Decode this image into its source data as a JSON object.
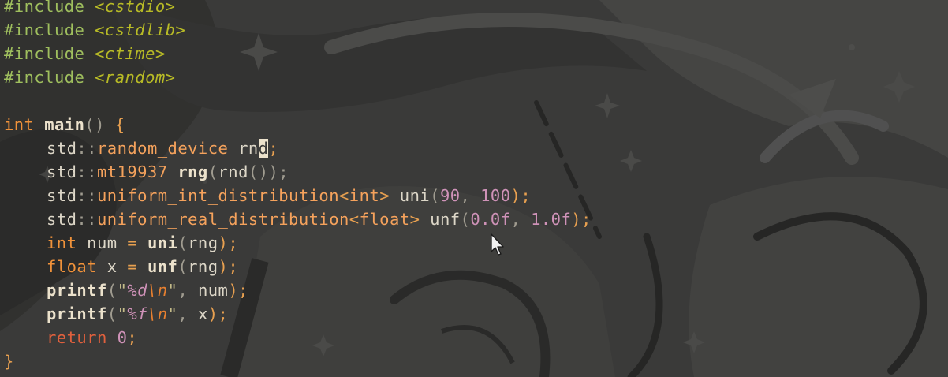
{
  "editor": {
    "lines": [
      {
        "tokens": [
          {
            "t": "#include ",
            "c": "c-pre"
          },
          {
            "t": "<cstdio>",
            "c": "c-hdr"
          }
        ]
      },
      {
        "tokens": [
          {
            "t": "#include ",
            "c": "c-pre"
          },
          {
            "t": "<cstdlib>",
            "c": "c-hdr"
          }
        ]
      },
      {
        "tokens": [
          {
            "t": "#include ",
            "c": "c-pre"
          },
          {
            "t": "<ctime>",
            "c": "c-hdr"
          }
        ]
      },
      {
        "tokens": [
          {
            "t": "#include ",
            "c": "c-pre"
          },
          {
            "t": "<random>",
            "c": "c-hdr"
          }
        ]
      },
      {
        "tokens": []
      },
      {
        "tokens": [
          {
            "t": "int",
            "c": "c-kw"
          },
          {
            "t": " ",
            "c": "c-var"
          },
          {
            "t": "main",
            "c": "c-fn"
          },
          {
            "t": "()",
            "c": "c-pu"
          },
          {
            "t": " {",
            "c": "c-op"
          }
        ]
      },
      {
        "indent": 1,
        "tokens": [
          {
            "t": "std",
            "c": "c-var"
          },
          {
            "t": "::",
            "c": "c-pu"
          },
          {
            "t": "random_device",
            "c": "c-ty"
          },
          {
            "t": " rn",
            "c": "c-var"
          },
          {
            "t": "d",
            "c": "cursor"
          },
          {
            "t": ";",
            "c": "c-op"
          }
        ]
      },
      {
        "indent": 1,
        "tokens": [
          {
            "t": "std",
            "c": "c-var"
          },
          {
            "t": "::",
            "c": "c-pu"
          },
          {
            "t": "mt19937",
            "c": "c-ty"
          },
          {
            "t": " ",
            "c": "c-var"
          },
          {
            "t": "rng",
            "c": "c-fn"
          },
          {
            "t": "(",
            "c": "c-pu"
          },
          {
            "t": "rnd",
            "c": "c-var"
          },
          {
            "t": "());",
            "c": "c-pu"
          }
        ]
      },
      {
        "indent": 1,
        "tokens": [
          {
            "t": "std",
            "c": "c-var"
          },
          {
            "t": "::",
            "c": "c-pu"
          },
          {
            "t": "uniform_int_distribution",
            "c": "c-ty"
          },
          {
            "t": "<",
            "c": "c-op"
          },
          {
            "t": "int",
            "c": "c-ty"
          },
          {
            "t": ">",
            "c": "c-op"
          },
          {
            "t": " uni",
            "c": "c-var"
          },
          {
            "t": "(",
            "c": "c-pu"
          },
          {
            "t": "90",
            "c": "c-num"
          },
          {
            "t": ", ",
            "c": "c-pu"
          },
          {
            "t": "100",
            "c": "c-num"
          },
          {
            "t": ");",
            "c": "c-op"
          }
        ]
      },
      {
        "indent": 1,
        "tokens": [
          {
            "t": "std",
            "c": "c-var"
          },
          {
            "t": "::",
            "c": "c-pu"
          },
          {
            "t": "uniform_real_distribution",
            "c": "c-ty"
          },
          {
            "t": "<",
            "c": "c-op"
          },
          {
            "t": "float",
            "c": "c-ty"
          },
          {
            "t": ">",
            "c": "c-op"
          },
          {
            "t": " unf",
            "c": "c-var"
          },
          {
            "t": "(",
            "c": "c-pu"
          },
          {
            "t": "0.0f",
            "c": "c-num"
          },
          {
            "t": ", ",
            "c": "c-pu"
          },
          {
            "t": "1.0f",
            "c": "c-num"
          },
          {
            "t": ");",
            "c": "c-op"
          }
        ]
      },
      {
        "indent": 1,
        "tokens": [
          {
            "t": "int",
            "c": "c-kw"
          },
          {
            "t": " num ",
            "c": "c-var"
          },
          {
            "t": "=",
            "c": "c-op"
          },
          {
            "t": " ",
            "c": "c-var"
          },
          {
            "t": "uni",
            "c": "c-fn"
          },
          {
            "t": "(",
            "c": "c-pu"
          },
          {
            "t": "rng",
            "c": "c-var"
          },
          {
            "t": ");",
            "c": "c-op"
          }
        ]
      },
      {
        "indent": 1,
        "tokens": [
          {
            "t": "float",
            "c": "c-kw"
          },
          {
            "t": " x ",
            "c": "c-var"
          },
          {
            "t": "=",
            "c": "c-op"
          },
          {
            "t": " ",
            "c": "c-var"
          },
          {
            "t": "unf",
            "c": "c-fn"
          },
          {
            "t": "(",
            "c": "c-pu"
          },
          {
            "t": "rng",
            "c": "c-var"
          },
          {
            "t": ");",
            "c": "c-op"
          }
        ]
      },
      {
        "indent": 1,
        "tokens": [
          {
            "t": "printf",
            "c": "c-fn"
          },
          {
            "t": "(",
            "c": "c-pu"
          },
          {
            "t": "\"",
            "c": "c-str"
          },
          {
            "t": "%d",
            "c": "c-fmt"
          },
          {
            "t": "\\n",
            "c": "c-esc"
          },
          {
            "t": "\"",
            "c": "c-str"
          },
          {
            "t": ", ",
            "c": "c-pu"
          },
          {
            "t": "num",
            "c": "c-var"
          },
          {
            "t": ");",
            "c": "c-op"
          }
        ]
      },
      {
        "indent": 1,
        "tokens": [
          {
            "t": "printf",
            "c": "c-fn"
          },
          {
            "t": "(",
            "c": "c-pu"
          },
          {
            "t": "\"",
            "c": "c-str"
          },
          {
            "t": "%f",
            "c": "c-fmt"
          },
          {
            "t": "\\n",
            "c": "c-esc"
          },
          {
            "t": "\"",
            "c": "c-str"
          },
          {
            "t": ", ",
            "c": "c-pu"
          },
          {
            "t": "x",
            "c": "c-var"
          },
          {
            "t": ");",
            "c": "c-op"
          }
        ]
      },
      {
        "indent": 1,
        "tokens": [
          {
            "t": "return",
            "c": "c-ret"
          },
          {
            "t": " ",
            "c": "c-var"
          },
          {
            "t": "0",
            "c": "c-num"
          },
          {
            "t": ";",
            "c": "c-op"
          }
        ]
      },
      {
        "tokens": [
          {
            "t": "}",
            "c": "c-op"
          }
        ]
      }
    ]
  },
  "mouse_pointer": {
    "icon": "arrow-pointer-icon"
  },
  "colors": {
    "background": "#3a3a39",
    "keyword": "#f0923a",
    "preprocessor": "#9fbf5e",
    "header": "#b8bb26",
    "number": "#cf92b8",
    "text": "#ddd7c8"
  }
}
